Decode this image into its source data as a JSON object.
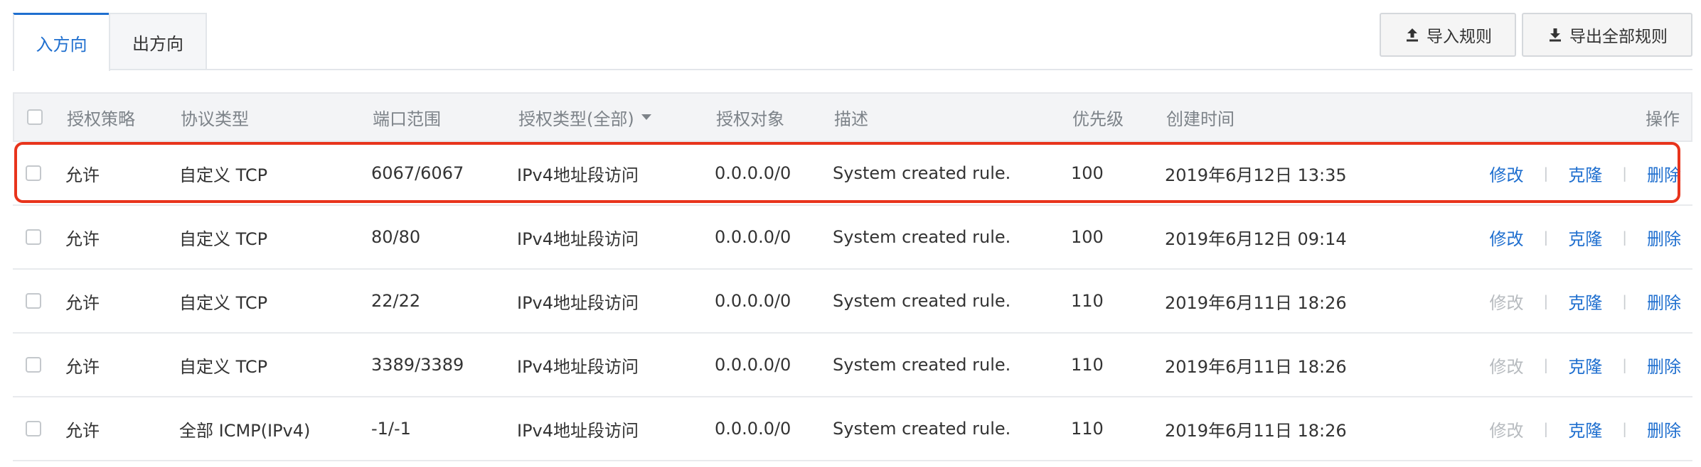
{
  "tabs": {
    "inbound": "入方向",
    "outbound": "出方向"
  },
  "toolbar": {
    "import_label": "导入规则",
    "export_label": "导出全部规则"
  },
  "table": {
    "headers": {
      "policy": "授权策略",
      "protocol": "协议类型",
      "port": "端口范围",
      "auth_type": "授权类型(全部)",
      "target": "授权对象",
      "description": "描述",
      "priority": "优先级",
      "created": "创建时间",
      "actions": "操作"
    },
    "rows": [
      {
        "policy": "允许",
        "protocol": "自定义 TCP",
        "port": "6067/6067",
        "auth_type": "IPv4地址段访问",
        "target": "0.0.0.0/0",
        "description": "System created rule.",
        "priority": "100",
        "created": "2019年6月12日 13:35",
        "edit": "修改",
        "clone": "克隆",
        "delete": "删除",
        "edit_enabled": true
      },
      {
        "policy": "允许",
        "protocol": "自定义 TCP",
        "port": "80/80",
        "auth_type": "IPv4地址段访问",
        "target": "0.0.0.0/0",
        "description": "System created rule.",
        "priority": "100",
        "created": "2019年6月12日 09:14",
        "edit": "修改",
        "clone": "克隆",
        "delete": "删除",
        "edit_enabled": true
      },
      {
        "policy": "允许",
        "protocol": "自定义 TCP",
        "port": "22/22",
        "auth_type": "IPv4地址段访问",
        "target": "0.0.0.0/0",
        "description": "System created rule.",
        "priority": "110",
        "created": "2019年6月11日 18:26",
        "edit": "修改",
        "clone": "克隆",
        "delete": "删除",
        "edit_enabled": false
      },
      {
        "policy": "允许",
        "protocol": "自定义 TCP",
        "port": "3389/3389",
        "auth_type": "IPv4地址段访问",
        "target": "0.0.0.0/0",
        "description": "System created rule.",
        "priority": "110",
        "created": "2019年6月11日 18:26",
        "edit": "修改",
        "clone": "克隆",
        "delete": "删除",
        "edit_enabled": false
      },
      {
        "policy": "允许",
        "protocol": "全部 ICMP(IPv4)",
        "port": "-1/-1",
        "auth_type": "IPv4地址段访问",
        "target": "0.0.0.0/0",
        "description": "System created rule.",
        "priority": "110",
        "created": "2019年6月11日 18:26",
        "edit": "修改",
        "clone": "克隆",
        "delete": "删除",
        "edit_enabled": false
      }
    ]
  },
  "colors": {
    "accent": "#1f6fcf",
    "highlight_border": "#e8341c",
    "disabled_text": "#b7bbbf"
  },
  "icons": {
    "import": "upload-icon",
    "export": "download-icon"
  }
}
